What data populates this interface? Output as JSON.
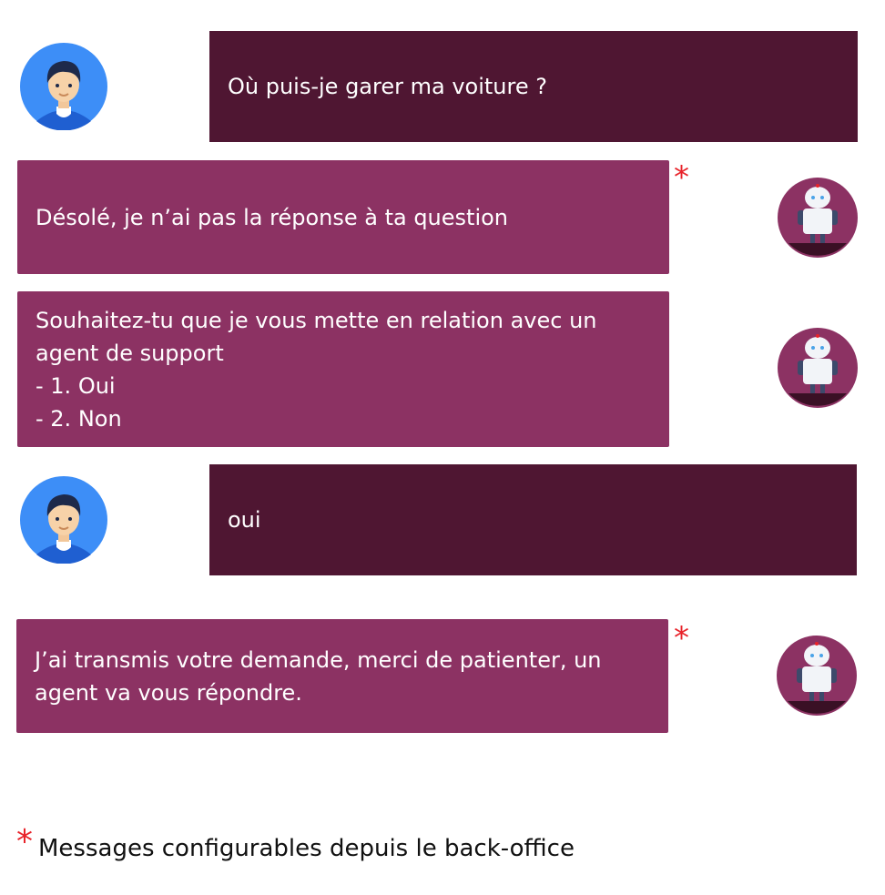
{
  "colors": {
    "user_bubble": "#4f1632",
    "bot_bubble": "#8c3263",
    "asterisk": "#e8232a",
    "user_avatar_bg": "#3d8ef7",
    "bot_avatar_bg": "#8c3263"
  },
  "messages": [
    {
      "sender": "user",
      "text": "Où puis-je garer ma voiture ?",
      "configurable": false,
      "avatar_icon": "user-avatar-icon"
    },
    {
      "sender": "bot",
      "text": "Désolé, je n’ai pas la réponse à ta question",
      "configurable": true,
      "avatar_icon": "robot-avatar-icon"
    },
    {
      "sender": "bot",
      "text": "Souhaitez-tu que je vous mette en relation avec un\nagent de support\n- 1. Oui\n- 2. Non",
      "configurable": false,
      "avatar_icon": "robot-avatar-icon"
    },
    {
      "sender": "user",
      "text": "oui",
      "configurable": false,
      "avatar_icon": "user-avatar-icon"
    },
    {
      "sender": "bot",
      "text": "J’ai transmis votre demande, merci de patienter, un\nagent va vous répondre.",
      "configurable": true,
      "avatar_icon": "robot-avatar-icon"
    }
  ],
  "footnote": {
    "marker": "*",
    "text": "Messages configurables depuis le back-office"
  }
}
